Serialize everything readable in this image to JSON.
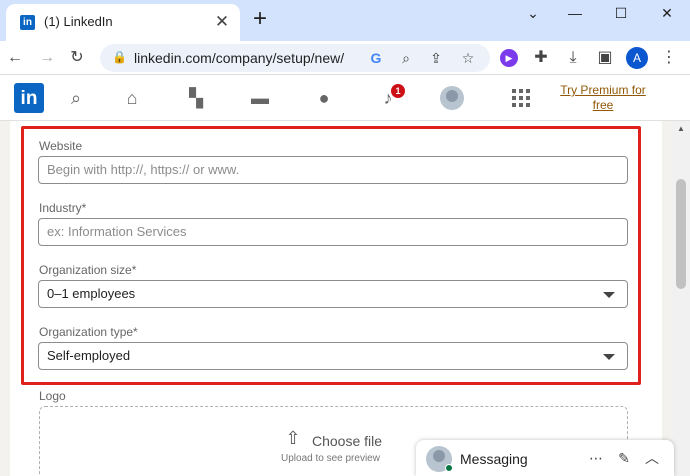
{
  "browser": {
    "tab_title": "(1) LinkedIn",
    "tab_favicon": "in",
    "url": "linkedin.com/company/setup/new/",
    "profile_initial": "A"
  },
  "nav": {
    "logo_text": "in",
    "notification_count": "1",
    "premium_label": "Try Premium for free"
  },
  "form": {
    "website": {
      "label": "Website",
      "placeholder": "Begin with http://, https:// or www.",
      "value": ""
    },
    "industry": {
      "label": "Industry*",
      "placeholder": "ex: Information Services",
      "value": ""
    },
    "org_size": {
      "label": "Organization size*",
      "value": "0–1 employees"
    },
    "org_type": {
      "label": "Organization type*",
      "value": "Self-employed"
    },
    "logo": {
      "label": "Logo",
      "choose_file": "Choose file",
      "hint": "Upload to see preview"
    }
  },
  "messaging": {
    "title": "Messaging"
  },
  "colors": {
    "linkedin_blue": "#0a66c2",
    "highlight_red": "#e0201b",
    "premium_gold": "#915907"
  }
}
